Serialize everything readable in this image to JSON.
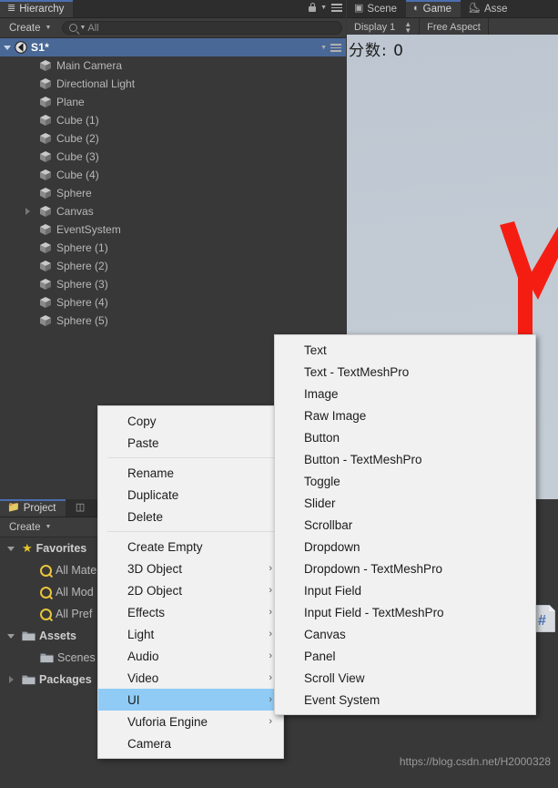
{
  "app": "Unity Editor",
  "hierarchy": {
    "tab_label": "Hierarchy",
    "tab_icon": "hierarchy-icon",
    "create_label": "Create",
    "search_placeholder": "All",
    "search_value": "All",
    "scene": {
      "name": "S1*",
      "expanded": true
    },
    "items": [
      {
        "label": "Main Camera",
        "indent": 1,
        "expandable": false
      },
      {
        "label": "Directional Light",
        "indent": 1,
        "expandable": false
      },
      {
        "label": "Plane",
        "indent": 1,
        "expandable": false
      },
      {
        "label": "Cube (1)",
        "indent": 1,
        "expandable": false
      },
      {
        "label": "Cube (2)",
        "indent": 1,
        "expandable": false
      },
      {
        "label": "Cube (3)",
        "indent": 1,
        "expandable": false
      },
      {
        "label": "Cube (4)",
        "indent": 1,
        "expandable": false
      },
      {
        "label": "Sphere",
        "indent": 1,
        "expandable": false
      },
      {
        "label": "Canvas",
        "indent": 1,
        "expandable": true
      },
      {
        "label": "EventSystem",
        "indent": 1,
        "expandable": false
      },
      {
        "label": "Sphere (1)",
        "indent": 1,
        "expandable": false
      },
      {
        "label": "Sphere (2)",
        "indent": 1,
        "expandable": false
      },
      {
        "label": "Sphere (3)",
        "indent": 1,
        "expandable": false
      },
      {
        "label": "Sphere (4)",
        "indent": 1,
        "expandable": false
      },
      {
        "label": "Sphere (5)",
        "indent": 1,
        "expandable": false
      }
    ]
  },
  "view_tabs": [
    {
      "label": "Scene",
      "icon": "grid-icon",
      "active": false
    },
    {
      "label": "Game",
      "icon": "gamepad-icon",
      "active": true
    },
    {
      "label": "Asse",
      "icon": "store-icon",
      "active": false
    }
  ],
  "game_toolbar": {
    "display": "Display 1",
    "aspect": "Free Aspect"
  },
  "game_view": {
    "score_text": "分数: 0",
    "background_color": "#c2cad4",
    "object_color": "#f51d12"
  },
  "project": {
    "tab_label": "Project",
    "tab_icon": "folder-icon",
    "second_tab_icon": "console-icon",
    "create_label": "Create",
    "items": [
      {
        "label": "Favorites",
        "icon": "star-icon",
        "indent": 0,
        "expanded": true,
        "bold": true
      },
      {
        "label": "All Mate",
        "icon": "search-icon",
        "indent": 1,
        "bold": false
      },
      {
        "label": "All Mod",
        "icon": "search-icon",
        "indent": 1,
        "bold": false
      },
      {
        "label": "All Pref",
        "icon": "search-icon",
        "indent": 1,
        "bold": false
      },
      {
        "label": "Assets",
        "icon": "folder-icon",
        "indent": 0,
        "expanded": true,
        "bold": true
      },
      {
        "label": "Scenes",
        "icon": "folder-icon",
        "indent": 1,
        "bold": false
      },
      {
        "label": "Packages",
        "icon": "folder-icon",
        "indent": 0,
        "expanded": false,
        "bold": true
      }
    ]
  },
  "context_menu": {
    "groups": [
      [
        {
          "label": "Copy"
        },
        {
          "label": "Paste"
        }
      ],
      [
        {
          "label": "Rename"
        },
        {
          "label": "Duplicate"
        },
        {
          "label": "Delete"
        }
      ],
      [
        {
          "label": "Create Empty"
        },
        {
          "label": "3D Object",
          "submenu": true
        },
        {
          "label": "2D Object",
          "submenu": true
        },
        {
          "label": "Effects",
          "submenu": true
        },
        {
          "label": "Light",
          "submenu": true
        },
        {
          "label": "Audio",
          "submenu": true
        },
        {
          "label": "Video",
          "submenu": true
        },
        {
          "label": "UI",
          "submenu": true,
          "selected": true
        },
        {
          "label": "Vuforia Engine",
          "submenu": true
        },
        {
          "label": "Camera"
        }
      ]
    ]
  },
  "submenu": {
    "title": "UI",
    "items": [
      {
        "label": "Text"
      },
      {
        "label": "Text - TextMeshPro"
      },
      {
        "label": "Image"
      },
      {
        "label": "Raw Image"
      },
      {
        "label": "Button"
      },
      {
        "label": "Button - TextMeshPro"
      },
      {
        "label": "Toggle"
      },
      {
        "label": "Slider"
      },
      {
        "label": "Scrollbar"
      },
      {
        "label": "Dropdown"
      },
      {
        "label": "Dropdown - TextMeshPro"
      },
      {
        "label": "Input Field"
      },
      {
        "label": "Input Field - TextMeshPro"
      },
      {
        "label": "Canvas"
      },
      {
        "label": "Panel"
      },
      {
        "label": "Scroll View"
      },
      {
        "label": "Event System"
      }
    ]
  },
  "watermark": "https://blog.csdn.net/H2000328",
  "colors": {
    "panel_bg": "#383838",
    "tab_bg": "#2d2d2d",
    "selection_blue": "#4a6896",
    "menu_bg": "#f1f1f1",
    "menu_highlight": "#8fcbf5",
    "accent_yellow": "#e8c53c"
  }
}
